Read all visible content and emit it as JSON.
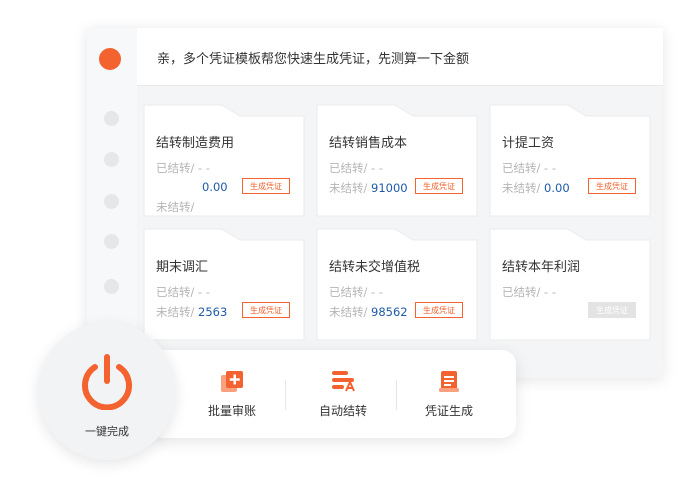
{
  "header": {
    "message": "亲，多个凭证模板帮您快速生成凭证，先测算一下金额"
  },
  "labels": {
    "done": "已结转/",
    "pending": "未结转/",
    "dash": "- -"
  },
  "cards": [
    {
      "title": "结转制造费用",
      "done_value": "- -",
      "pending_value": "0.00",
      "button": "生成凭证"
    },
    {
      "title": "结转销售成本",
      "done_value": "- -",
      "pending_value": "91000",
      "button": "生成凭证"
    },
    {
      "title": "计提工资",
      "done_value": "- -",
      "pending_value": "0.00",
      "button": "生成凭证"
    },
    {
      "title": "期末调汇",
      "done_value": "- -",
      "pending_value": "2563",
      "button": "生成凭证"
    },
    {
      "title": "结转未交增值税",
      "done_value": "- -",
      "pending_value": "98562",
      "button": "生成凭证"
    },
    {
      "title": "结转本年利润",
      "done_value": "- -",
      "button": "生成凭证",
      "disabled": true
    }
  ],
  "toolbar": {
    "items": [
      {
        "label": "批量审账",
        "icon": "batch-review-icon"
      },
      {
        "label": "自动结转",
        "icon": "auto-transfer-icon"
      },
      {
        "label": "凭证生成",
        "icon": "voucher-generate-icon"
      }
    ]
  },
  "power": {
    "label": "一键完成",
    "icon": "power-icon"
  },
  "colors": {
    "accent": "#f4622f",
    "value": "#1f5aa6",
    "muted": "#b5b5b5"
  }
}
